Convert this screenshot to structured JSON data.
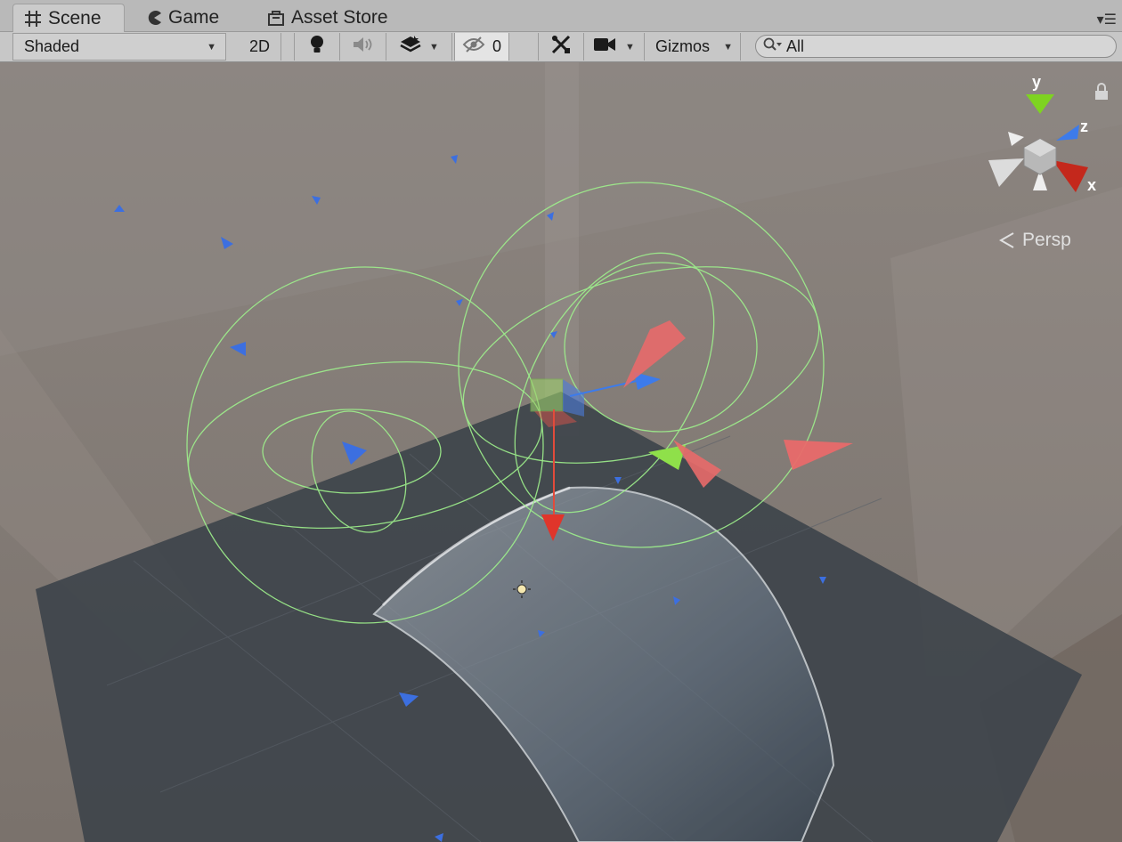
{
  "tabs": [
    {
      "label": "Scene",
      "icon": "grid-icon",
      "active": true
    },
    {
      "label": "Game",
      "icon": "pacman-icon",
      "active": false
    },
    {
      "label": "Asset Store",
      "icon": "store-bag-icon",
      "active": false
    }
  ],
  "toolbar": {
    "draw_mode": "Shaded",
    "two_d_label": "2D",
    "hidden_count": "0",
    "gizmos_label": "Gizmos",
    "search_value": "All"
  },
  "scene": {
    "projection_label": "Persp",
    "axes": {
      "x": "x",
      "y": "y",
      "z": "z"
    }
  },
  "colors": {
    "gizmo_green": "#9ef08c",
    "axis_x": "#e24b3b",
    "axis_y": "#7ed321",
    "axis_z": "#3d7bea",
    "plane": "#3e444b"
  }
}
